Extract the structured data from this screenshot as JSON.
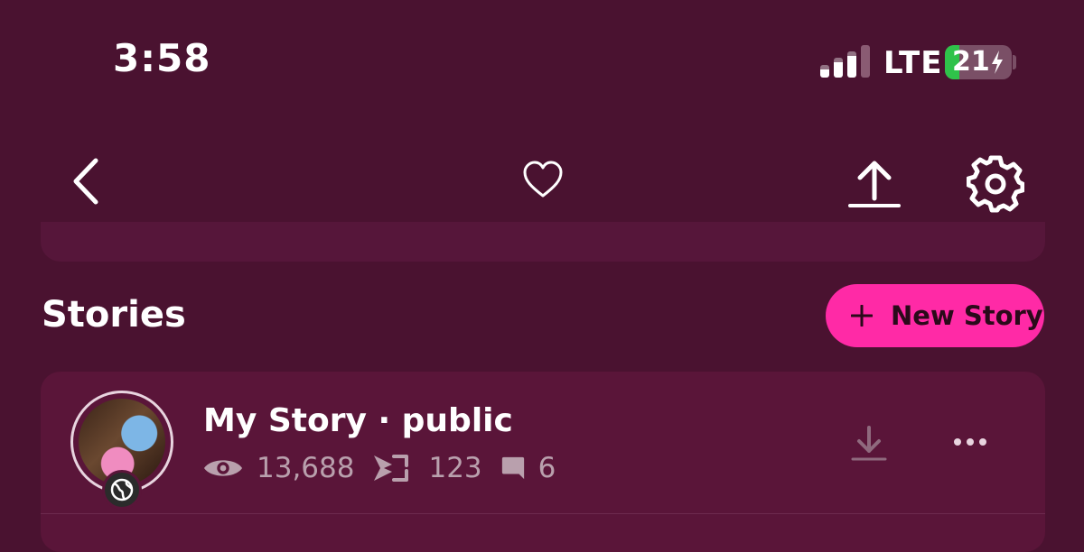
{
  "status_bar": {
    "time": "3:58",
    "network": "LTE",
    "battery_percent": "21",
    "battery_level": 0.21,
    "colors": {
      "battery_fill": "#2fc24a"
    }
  },
  "nav": {
    "icons": [
      "back-icon",
      "heart-icon",
      "share-icon",
      "gear-icon"
    ]
  },
  "stories": {
    "title": "Stories",
    "new_story_label": "New Story",
    "items": [
      {
        "name": "My Story · public",
        "views": "13,688",
        "screenshots": "123",
        "replies": "6"
      }
    ]
  },
  "colors": {
    "background": "#4a1230",
    "accent": "#ff2aa6",
    "card": "#5a1539",
    "muted_text": "#b9a0ad"
  }
}
